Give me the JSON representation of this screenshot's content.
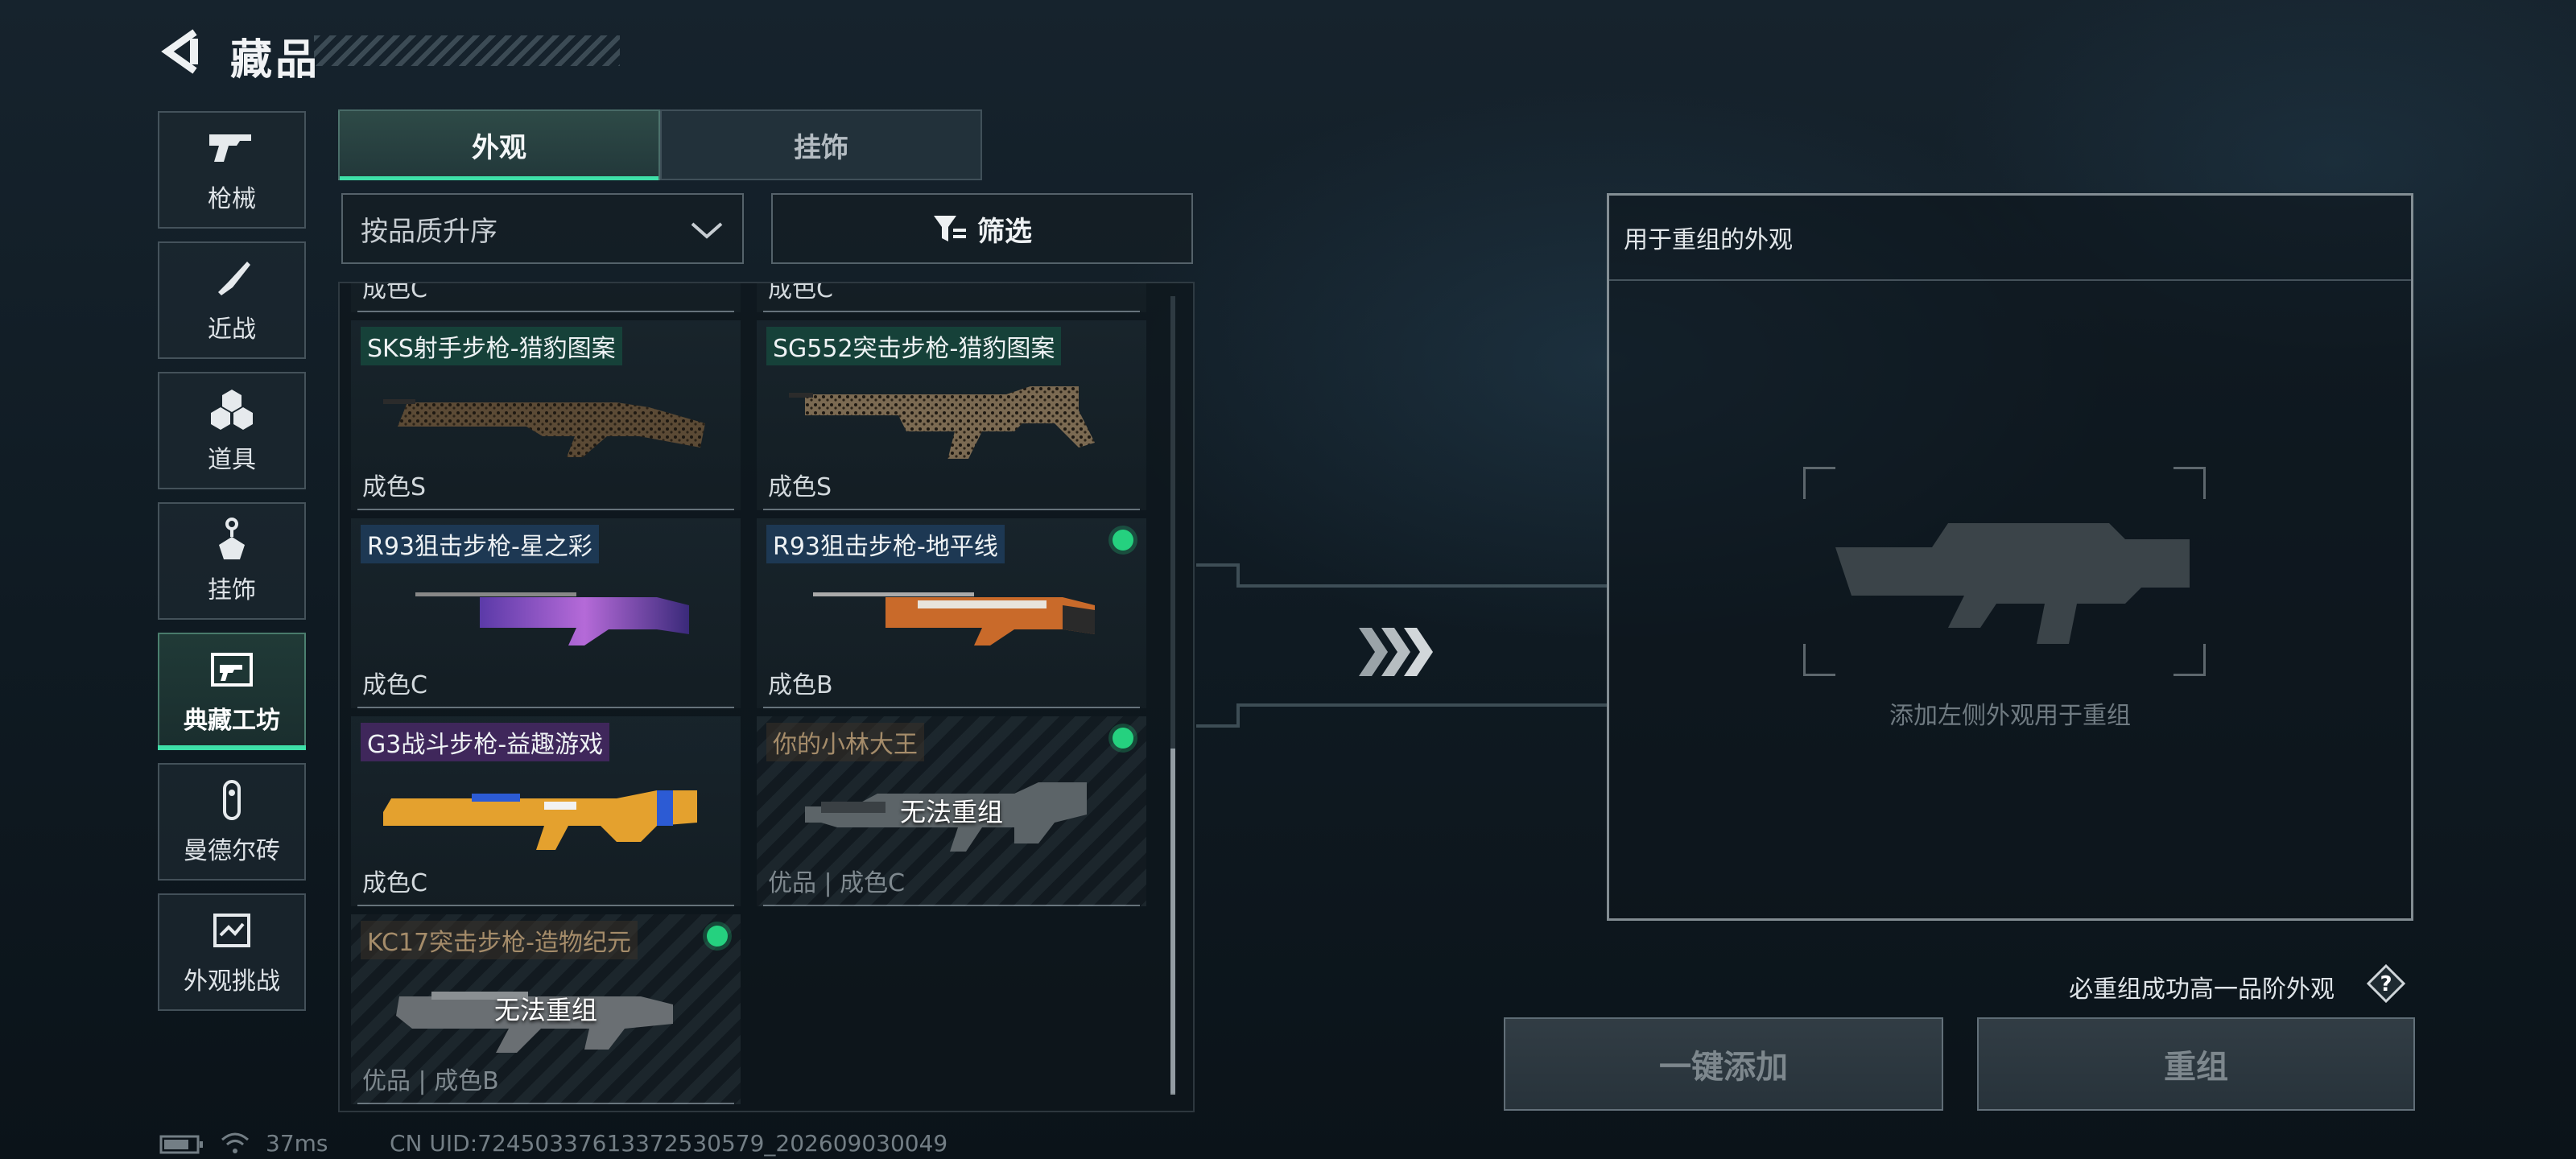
{
  "header": {
    "title": "藏品",
    "back_icon": "back-arrow-icon"
  },
  "sidebar": {
    "items": [
      {
        "label": "枪械",
        "icon": "gun-icon"
      },
      {
        "label": "近战",
        "icon": "knife-icon"
      },
      {
        "label": "道具",
        "icon": "grenades-icon"
      },
      {
        "label": "挂饰",
        "icon": "charm-icon"
      },
      {
        "label": "典藏工坊",
        "icon": "workshop-icon",
        "active": true
      },
      {
        "label": "曼德尔砖",
        "icon": "brick-icon"
      },
      {
        "label": "外观挑战",
        "icon": "challenge-icon"
      }
    ]
  },
  "tabs": [
    {
      "label": "外观",
      "active": true
    },
    {
      "label": "挂饰",
      "active": false
    }
  ],
  "controls": {
    "sort_label": "按品质升序",
    "filter_label": "筛选"
  },
  "cards": [
    {
      "name": "SKS射手步枪-猎豹图案",
      "grade": "成色S",
      "selected": false,
      "name_style": "green"
    },
    {
      "name": "SG552突击步枪-猎豹图案",
      "grade": "成色S",
      "selected": false,
      "name_style": "green"
    },
    {
      "name": "R93狙击步枪-星之彩",
      "grade": "成色C",
      "selected": false,
      "name_style": "blue"
    },
    {
      "name": "R93狙击步枪-地平线",
      "grade": "成色B",
      "selected": true,
      "name_style": "blue"
    },
    {
      "name": "G3战斗步枪-益趣游戏",
      "grade": "成色C",
      "selected": false,
      "name_style": "purple"
    },
    {
      "name": "你的小林大王",
      "grade": "优品 | 成色C",
      "selected": true,
      "disabled": true,
      "disabled_text": "无法重组"
    },
    {
      "name": "KC17突击步枪-造物纪元",
      "grade": "优品 | 成色B",
      "selected": true,
      "disabled": true,
      "disabled_text": "无法重组"
    }
  ],
  "partial_row": {
    "left": "成色C",
    "right": "成色C"
  },
  "reassemble_panel": {
    "title": "用于重组的外观",
    "hint": "添加左侧外观用于重组",
    "rule_text": "必重组成功高一品阶外观",
    "help_icon": "question-icon"
  },
  "actions": {
    "add_all": "一键添加",
    "reassemble": "重组"
  },
  "status_bar": {
    "ping": "37ms",
    "uid": "CN UID:72450337613372530579_202609030049"
  },
  "colors": {
    "accent": "#3ee0a8",
    "selected_dot": "#25d17f"
  }
}
